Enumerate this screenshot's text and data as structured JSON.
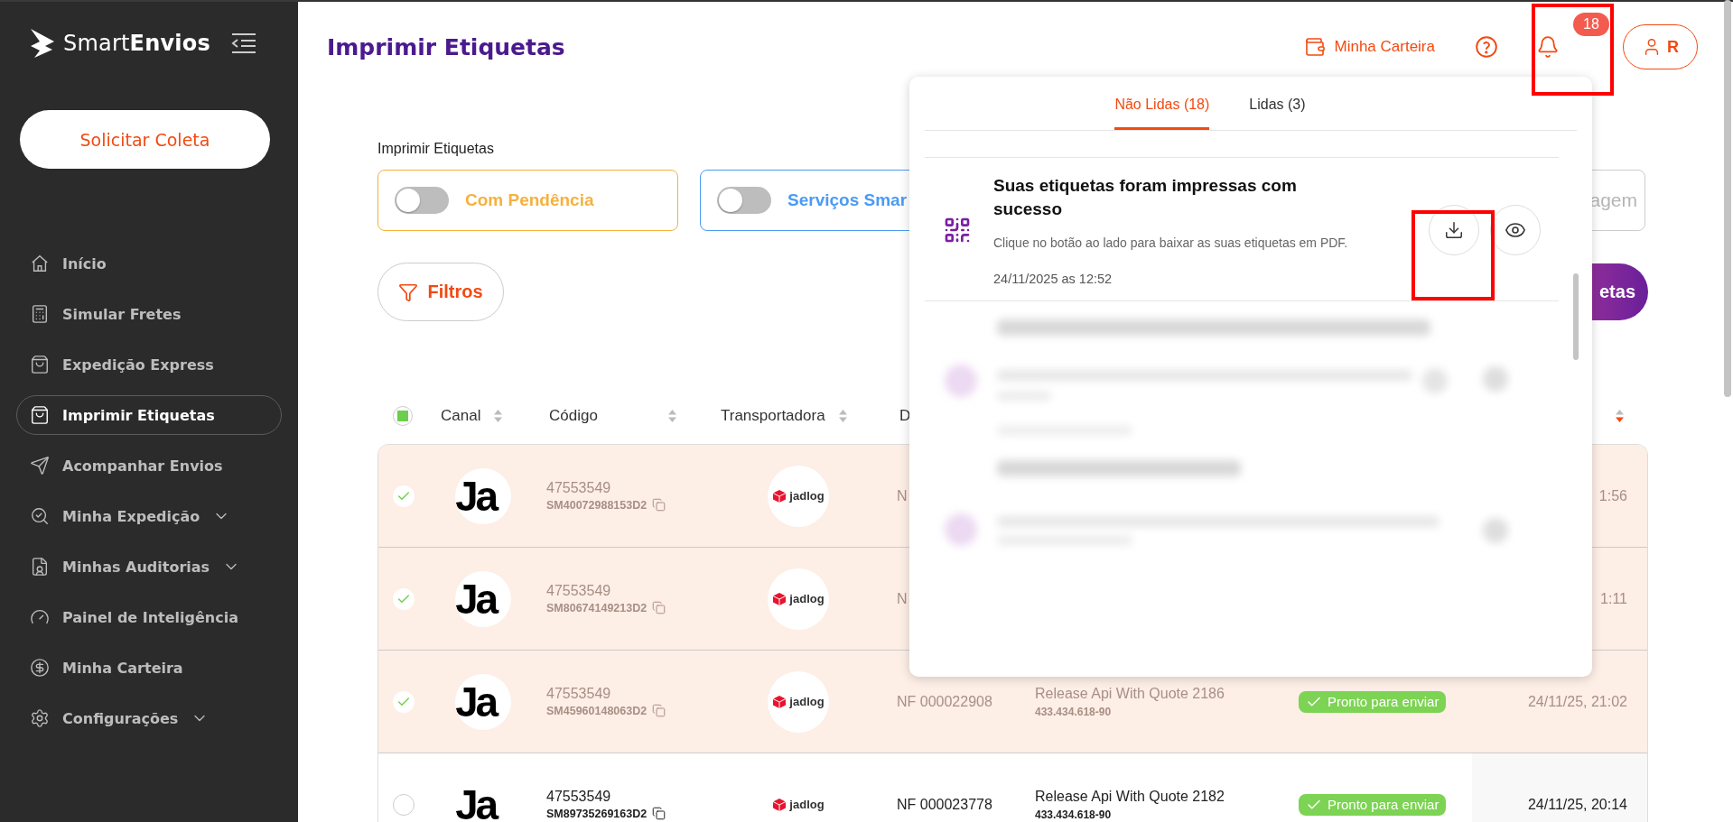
{
  "sidebar": {
    "brand": {
      "light": "Smart",
      "bold": "Envios"
    },
    "cta": "Solicitar Coleta",
    "items": [
      {
        "label": "Início",
        "selected": false,
        "expandable": false
      },
      {
        "label": "Simular Fretes",
        "selected": false,
        "expandable": false
      },
      {
        "label": "Expedição Express",
        "selected": false,
        "expandable": false
      },
      {
        "label": "Imprimir Etiquetas",
        "selected": true,
        "expandable": false
      },
      {
        "label": "Acompanhar Envios",
        "selected": false,
        "expandable": false
      },
      {
        "label": "Minha Expedição",
        "selected": false,
        "expandable": true
      },
      {
        "label": "Minhas Auditorias",
        "selected": false,
        "expandable": true
      },
      {
        "label": "Painel de Inteligência",
        "selected": false,
        "expandable": false
      },
      {
        "label": "Minha Carteira",
        "selected": false,
        "expandable": false
      },
      {
        "label": "Configurações",
        "selected": false,
        "expandable": true
      }
    ]
  },
  "header": {
    "title": "Imprimir Etiquetas",
    "wallet_link": "Minha Carteira",
    "notification_count": "18",
    "user_initial": "R"
  },
  "filters": {
    "label": "Imprimir Etiquetas",
    "toggles": [
      {
        "label": "Com Pendência",
        "on": false,
        "color": "#f6b13e"
      },
      {
        "label": "Serviços Smar",
        "on": false,
        "color": "#4a9bf5"
      }
    ],
    "card_4": "agem",
    "filter_button": "Filtros",
    "print_button": "etas"
  },
  "table": {
    "select_all": {
      "checked": true
    },
    "columns": [
      {
        "label": "Canal",
        "sortable": true
      },
      {
        "label": "Código",
        "sortable": true
      },
      {
        "label": "Transportadora",
        "sortable": true
      },
      {
        "label": "D"
      }
    ],
    "date_sorted_desc": true,
    "rows": [
      {
        "selected": true,
        "channel": "Ja",
        "order": "47553549",
        "code": "SM40072988153D2",
        "carrier": "jadlog",
        "nf": "N",
        "date": "1:56"
      },
      {
        "selected": true,
        "channel": "Ja",
        "order": "47553549",
        "code": "SM80674149213D2",
        "carrier": "jadlog",
        "nf": "N",
        "date": "1:11"
      },
      {
        "selected": true,
        "channel": "Ja",
        "order": "47553549",
        "code": "SM45960148063D2",
        "carrier": "jadlog",
        "nf": "NF 000022908",
        "description": "Release Api With Quote 2186",
        "document": "433.434.618-90",
        "status": {
          "label": "Pronto para enviar",
          "kind": "ready"
        },
        "date": "24/11/25, 21:02"
      },
      {
        "selected": false,
        "channel": "Ja",
        "order": "47553549",
        "code": "SM89735269163D2",
        "carrier": "jadlog",
        "nf": "NF 000023778",
        "description": "Release Api With Quote 2182",
        "document": "433.434.618-90",
        "status": {
          "label": "Pronto para enviar",
          "kind": "ready"
        },
        "date": "24/11/25, 20:14"
      }
    ]
  },
  "notifications": {
    "tabs": [
      {
        "label": "Não Lidas (18)",
        "selected": true
      },
      {
        "label": "Lidas (3)",
        "selected": false
      }
    ],
    "items": [
      {
        "title": "Suas etiquetas foram impressas com sucesso",
        "text": "Clique no botão ao lado para baixar as suas etiquetas em PDF.",
        "date": "24/11/2025 as 12:52"
      }
    ]
  }
}
